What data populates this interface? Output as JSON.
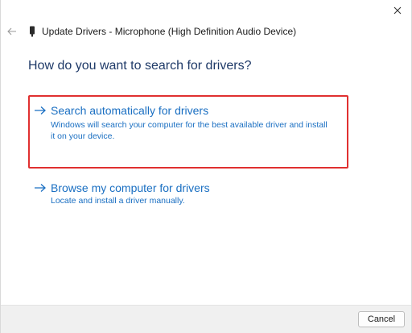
{
  "window": {
    "title": "Update Drivers - Microphone (High Definition Audio Device)"
  },
  "heading": "How do you want to search for drivers?",
  "options": [
    {
      "title": "Search automatically for drivers",
      "description": "Windows will search your computer for the best available driver and install it on your device."
    },
    {
      "title": "Browse my computer for drivers",
      "description": "Locate and install a driver manually."
    }
  ],
  "footer": {
    "cancel_label": "Cancel"
  },
  "colors": {
    "link_blue": "#1a6fc2",
    "heading_blue": "#1f3a68",
    "highlight_red": "#e03030"
  },
  "icons": {
    "close": "close-icon",
    "back": "back-arrow-icon",
    "device": "device-icon",
    "option_arrow": "right-arrow-icon"
  }
}
